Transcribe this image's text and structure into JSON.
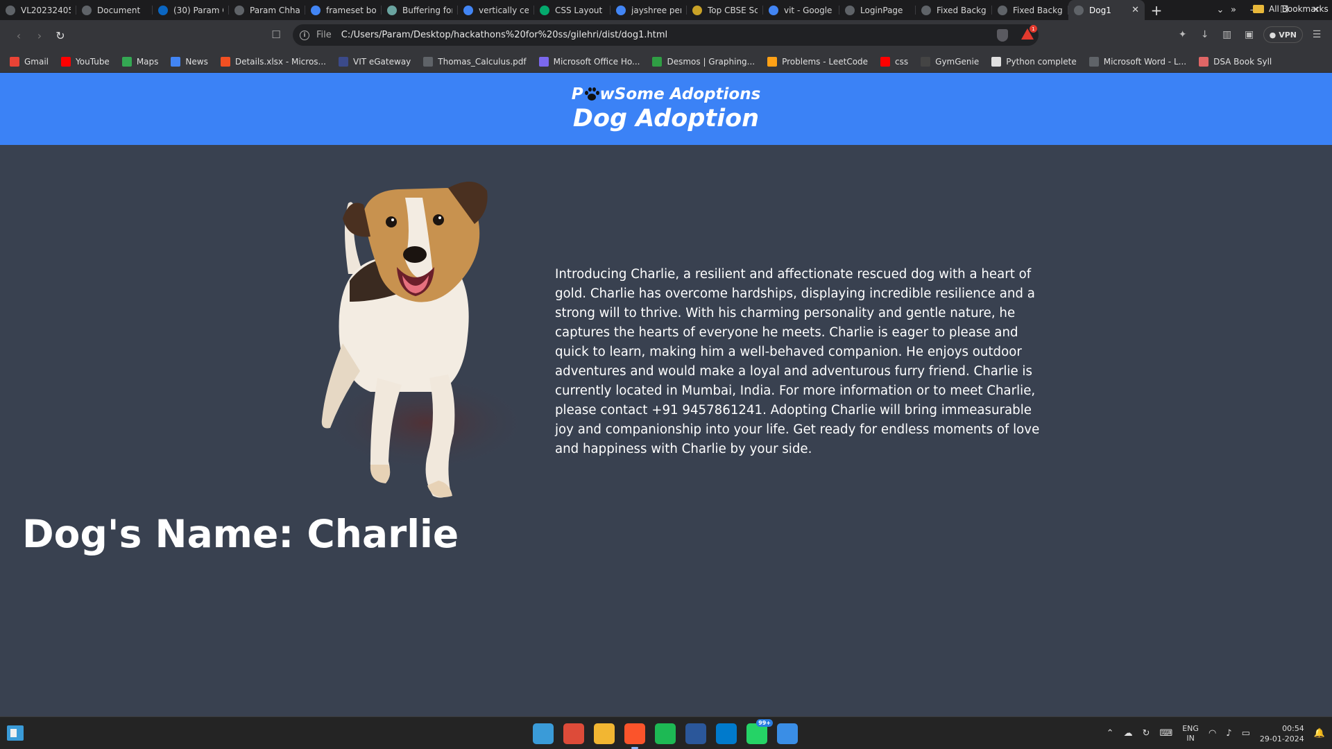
{
  "browser": {
    "tabs": [
      {
        "title": "VL202324050",
        "icon": "globe-icon",
        "color": "#5f6368"
      },
      {
        "title": "Document",
        "icon": "globe-icon",
        "color": "#5f6368"
      },
      {
        "title": "(30) Param Ch",
        "icon": "linkedin-icon",
        "color": "#0a66c2"
      },
      {
        "title": "Param Chhab",
        "icon": "globe-icon",
        "color": "#5f6368"
      },
      {
        "title": "frameset bord",
        "icon": "google-icon",
        "color": "#4285f4"
      },
      {
        "title": "Buffering for",
        "icon": "page-icon",
        "color": "#6aa4a0"
      },
      {
        "title": "vertically cent",
        "icon": "google-icon",
        "color": "#4285f4"
      },
      {
        "title": "CSS Layout -",
        "icon": "w3schools-icon",
        "color": "#04aa6d"
      },
      {
        "title": "jayshree peri",
        "icon": "google-icon",
        "color": "#4285f4"
      },
      {
        "title": "Top CBSE Sch",
        "icon": "school-icon",
        "color": "#c9a227"
      },
      {
        "title": "vit - Google S",
        "icon": "google-icon",
        "color": "#4285f4"
      },
      {
        "title": "LoginPage",
        "icon": "globe-icon",
        "color": "#5f6368"
      },
      {
        "title": "Fixed Backgro",
        "icon": "globe-icon",
        "color": "#5f6368"
      },
      {
        "title": "Fixed Backgro",
        "icon": "globe-icon",
        "color": "#5f6368"
      },
      {
        "title": "Dog1",
        "icon": "globe-icon",
        "color": "#5f6368",
        "active": true
      }
    ],
    "address": {
      "scheme": "File",
      "url": "C:/Users/Param/Desktop/hackathons%20for%20ss/gilehri/dist/dog1.html"
    },
    "rewards_badge": "1",
    "vpn_label": "VPN",
    "bookmarks": [
      {
        "label": "Gmail",
        "icon": "gmail-icon",
        "color": "#ea4335"
      },
      {
        "label": "YouTube",
        "icon": "youtube-icon",
        "color": "#ff0000"
      },
      {
        "label": "Maps",
        "icon": "maps-icon",
        "color": "#34a853"
      },
      {
        "label": "News",
        "icon": "news-icon",
        "color": "#4285f4"
      },
      {
        "label": "Details.xlsx - Micros...",
        "icon": "microsoft-icon",
        "color": "#f25022"
      },
      {
        "label": "VIT eGateway",
        "icon": "vit-icon",
        "color": "#3b4a8a"
      },
      {
        "label": "Thomas_Calculus.pdf",
        "icon": "globe-icon",
        "color": "#5f6368"
      },
      {
        "label": "Microsoft Office Ho...",
        "icon": "office-icon",
        "color": "#7b68ee"
      },
      {
        "label": "Desmos | Graphing...",
        "icon": "desmos-icon",
        "color": "#2f9e44"
      },
      {
        "label": "Problems - LeetCode",
        "icon": "leetcode-icon",
        "color": "#ffa116"
      },
      {
        "label": "css",
        "icon": "youtube-icon",
        "color": "#ff0000"
      },
      {
        "label": "GymGenie",
        "icon": "gym-icon",
        "color": "#444444"
      },
      {
        "label": "Python complete",
        "icon": "github-icon",
        "color": "#e0e0e0"
      },
      {
        "label": "Microsoft Word - L...",
        "icon": "globe-icon",
        "color": "#5f6368"
      },
      {
        "label": "DSA Book Syll",
        "icon": "book-icon",
        "color": "#e06666"
      }
    ],
    "more_glyph": "»",
    "all_bookmarks": "All Bookmarks"
  },
  "site": {
    "brand_before": "P",
    "brand_after": "wSome Adoptions",
    "title": "Dog Adoption",
    "header_color": "#3b82f6",
    "background": "#394150",
    "dog_photo_alt": "dog-photo",
    "description": "Introducing Charlie, a resilient and affectionate rescued dog with a heart of gold. Charlie has overcome hardships, displaying incredible resilience and a strong will to thrive. With his charming personality and gentle nature, he captures the hearts of everyone he meets. Charlie is eager to please and quick to learn, making him a well-behaved companion. He enjoys outdoor adventures and would make a loyal and adventurous furry friend. Charlie is currently located in Mumbai, India. For more information or to meet Charlie, please contact +91 9457861241. Adopting Charlie will bring immeasurable joy and companionship into your life. Get ready for endless moments of love and happiness with Charlie by your side.",
    "dog_name": "Dog's Name: Charlie"
  },
  "taskbar": {
    "apps": [
      {
        "name": "windows-start-icon",
        "color": "#3a9bd8"
      },
      {
        "name": "chrome-icon",
        "color": "#dd4b39",
        "badge": ""
      },
      {
        "name": "file-explorer-icon",
        "color": "#f2b632"
      },
      {
        "name": "brave-icon",
        "color": "#fb542b",
        "active": true
      },
      {
        "name": "spotify-icon",
        "color": "#1db954"
      },
      {
        "name": "word-icon",
        "color": "#2b579a"
      },
      {
        "name": "vscode-icon",
        "color": "#007acc"
      },
      {
        "name": "whatsapp-icon",
        "color": "#25d366",
        "badge": "99+"
      },
      {
        "name": "photos-icon",
        "color": "#3a8ee6"
      }
    ],
    "lang_top": "ENG",
    "lang_bottom": "IN",
    "time": "00:54",
    "date": "29-01-2024"
  }
}
